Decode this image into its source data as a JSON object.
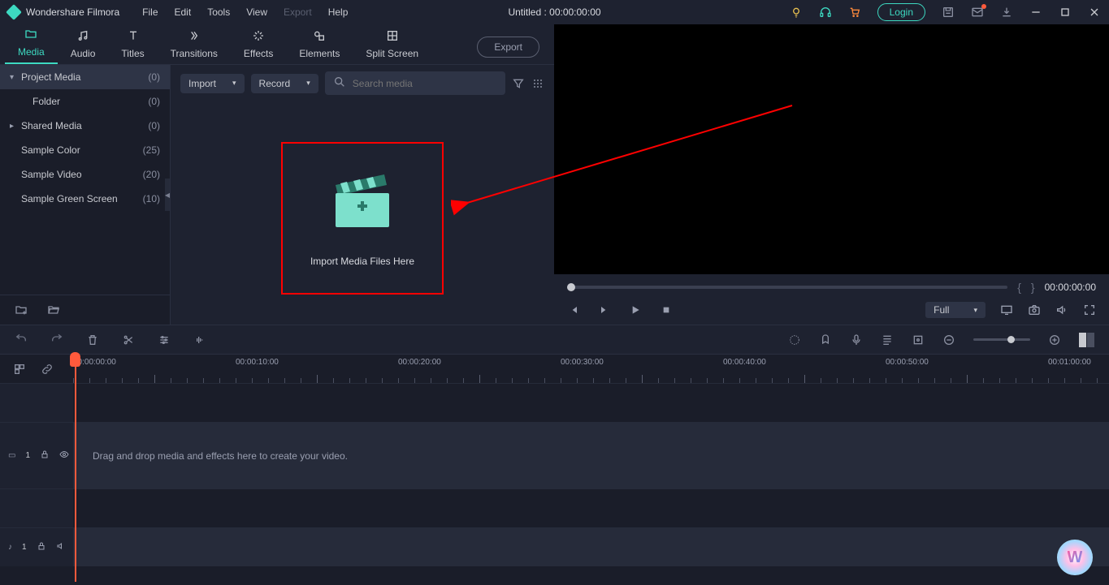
{
  "app": {
    "name": "Wondershare Filmora",
    "title": "Untitled : 00:00:00:00"
  },
  "menu": {
    "file": "File",
    "edit": "Edit",
    "tools": "Tools",
    "view": "View",
    "export": "Export",
    "help": "Help"
  },
  "login": "Login",
  "tabs": {
    "media": "Media",
    "audio": "Audio",
    "titles": "Titles",
    "transitions": "Transitions",
    "effects": "Effects",
    "elements": "Elements",
    "splitscreen": "Split Screen"
  },
  "exportBtn": "Export",
  "sidebar": {
    "items": [
      {
        "label": "Project Media",
        "count": "(0)"
      },
      {
        "label": "Folder",
        "count": "(0)"
      },
      {
        "label": "Shared Media",
        "count": "(0)"
      },
      {
        "label": "Sample Color",
        "count": "(25)"
      },
      {
        "label": "Sample Video",
        "count": "(20)"
      },
      {
        "label": "Sample Green Screen",
        "count": "(10)"
      }
    ]
  },
  "mediaToolbar": {
    "import": "Import",
    "record": "Record",
    "searchPlaceholder": "Search media"
  },
  "dropzone": {
    "text": "Import Media Files Here"
  },
  "preview": {
    "time": "00:00:00:00",
    "quality": "Full"
  },
  "ruler": [
    "00:00:00:00",
    "00:00:10:00",
    "00:00:20:00",
    "00:00:30:00",
    "00:00:40:00",
    "00:00:50:00",
    "00:01:00:00"
  ],
  "tracks": {
    "video": {
      "label": "1",
      "hint": "Drag and drop media and effects here to create your video."
    },
    "audio": {
      "label": "1"
    }
  }
}
